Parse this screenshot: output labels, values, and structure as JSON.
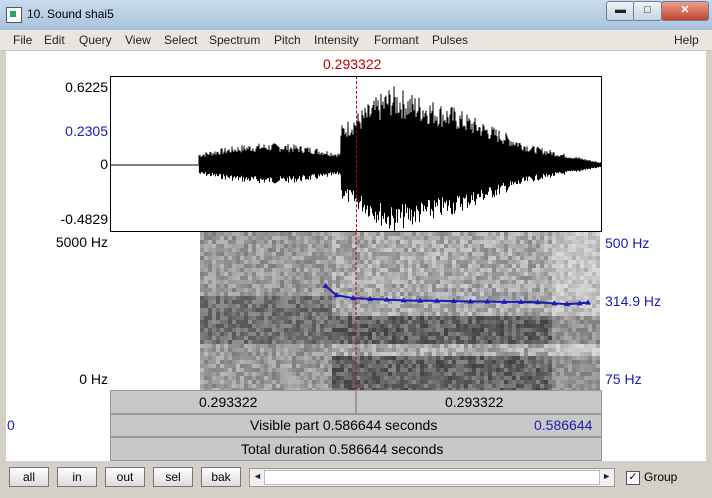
{
  "window": {
    "title": "10. Sound shai5",
    "minimize": "▬",
    "maximize": "□",
    "close": "✕"
  },
  "menu": [
    "File",
    "Edit",
    "Query",
    "View",
    "Select",
    "Spectrum",
    "Pitch",
    "Intensity",
    "Formant",
    "Pulses",
    "Help"
  ],
  "cursor_time": "0.293322",
  "waveform": {
    "max": "0.6225",
    "mid_blue": "0.2305",
    "zero": "0",
    "min": "-0.4829"
  },
  "spectrogram": {
    "top": "5000 Hz",
    "bottom": "0 Hz"
  },
  "pitch": {
    "top": "500 Hz",
    "value": "314.9 Hz",
    "bottom": "75 Hz",
    "color": "#1a1ab4"
  },
  "bars": {
    "left_time": "0.293322",
    "right_time": "0.293322",
    "visible_start": "0",
    "visible_label": "Visible part 0.586644 seconds",
    "visible_end": "0.586644",
    "total_label": "Total duration 0.586644 seconds"
  },
  "buttons": [
    "all",
    "in",
    "out",
    "sel",
    "bak"
  ],
  "group": {
    "label": "Group",
    "checked": "✓"
  },
  "scroll": {
    "left_arrow": "◄",
    "right_arrow": "►"
  },
  "chart_data": {
    "type": "line",
    "x_range_seconds": [
      0,
      0.586644
    ],
    "cursor": 0.293322,
    "series": [
      {
        "x": [
          0.257,
          0.27,
          0.29,
          0.31,
          0.33,
          0.35,
          0.37,
          0.39,
          0.41,
          0.43,
          0.45,
          0.47,
          0.49,
          0.51,
          0.53,
          0.545,
          0.56,
          0.57
        ],
        "y": [
          355,
          330,
          322,
          320,
          318,
          316,
          315,
          315,
          314,
          313,
          313,
          312,
          312,
          311,
          308,
          306,
          308,
          310
        ]
      }
    ],
    "ylim": [
      75,
      500
    ]
  }
}
